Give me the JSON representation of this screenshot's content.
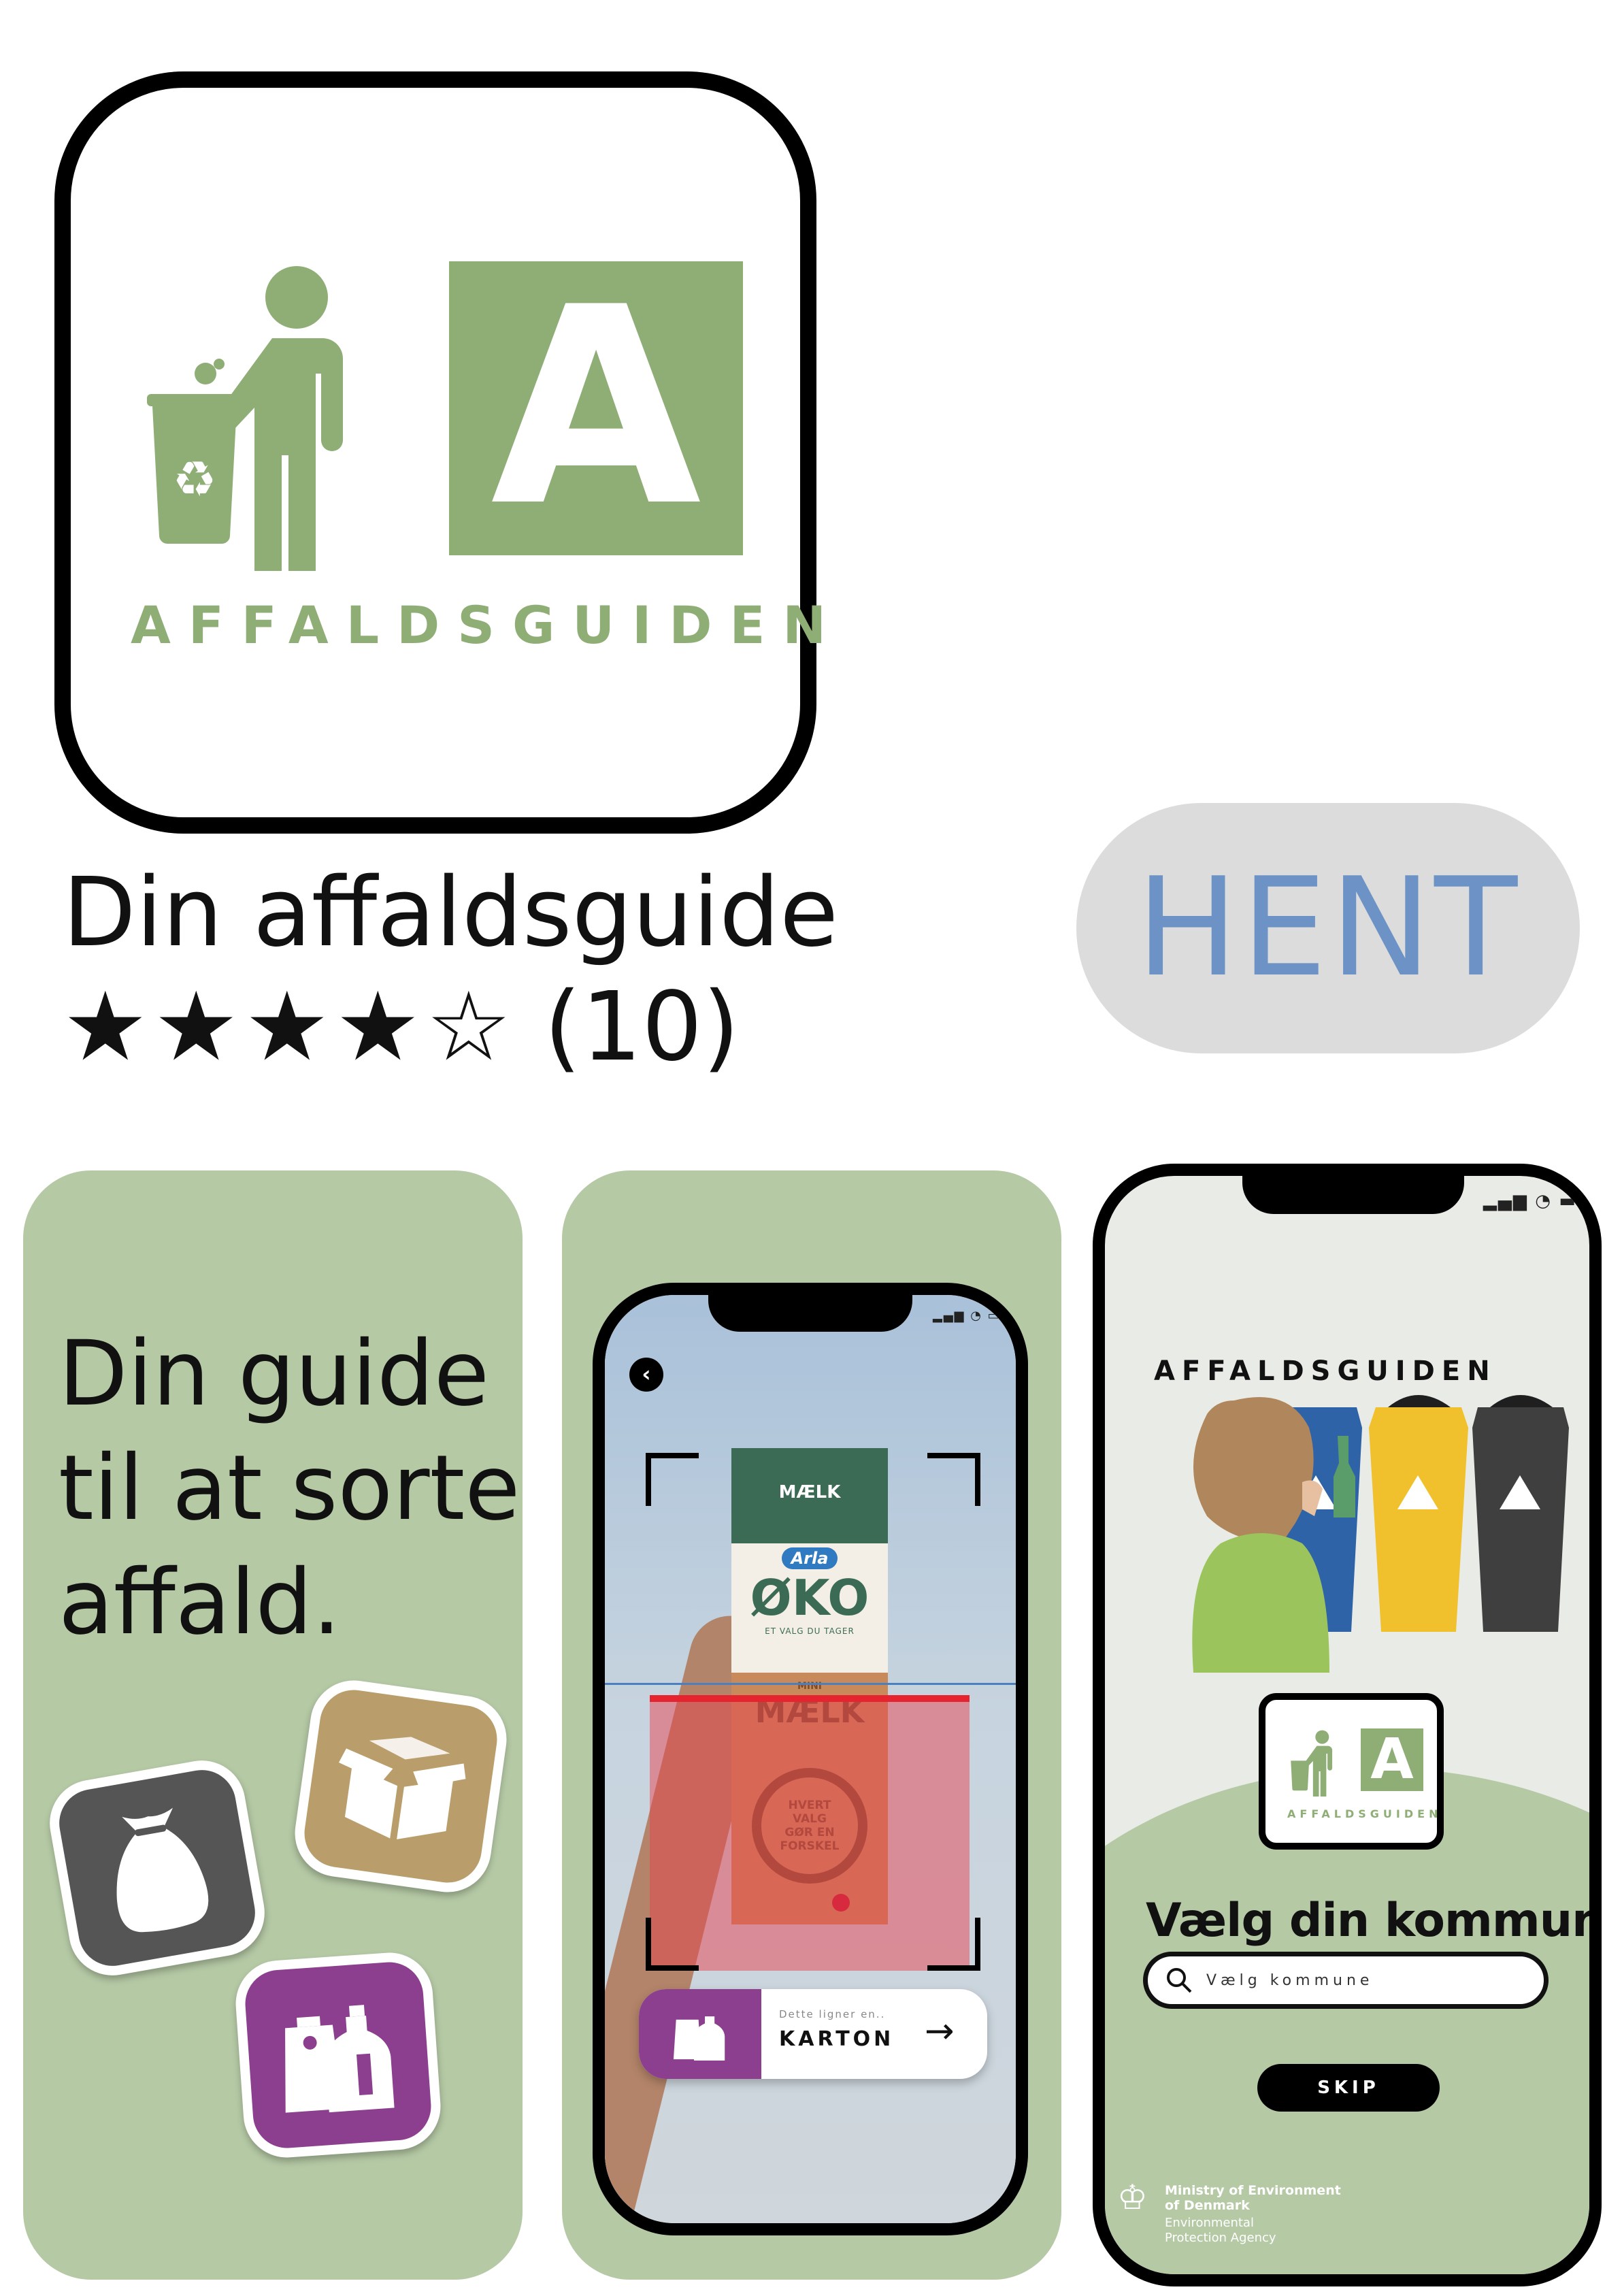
{
  "app": {
    "logo_text": "AFFALDSGUIDEN",
    "logo_letter": "A",
    "name": "Din affaldsguide",
    "rating": 4,
    "rating_max": 5,
    "rating_count": "(10)",
    "get_label": "HENT"
  },
  "colors": {
    "logo_green": "#8fae76",
    "card_green": "#b5c9a5",
    "get_text": "#6d93c6",
    "get_bg": "#dcdcdc",
    "residual_waste": "#555555",
    "cardboard": "#b99d6b",
    "plastic_cartons": "#8c3f8e"
  },
  "screens": [
    {
      "text": "Din guide\ntil at sorte\naffald.",
      "icons": [
        "trash-bag-icon",
        "cardboard-box-icon",
        "plastic-cartons-icon"
      ]
    },
    {
      "package": {
        "brand": "Arla",
        "product": "ØKO",
        "tagline": "ET VALG DU TAGER",
        "top_label": "MÆLK",
        "size_label": "MINI",
        "milk_label": "MÆLK",
        "slogan": "HVERT\nVALG\nGØR EN\nFORSKEL"
      },
      "result": {
        "hint": "Dette ligner en..",
        "label": "KARTON"
      }
    },
    {
      "header": "AFFALDSGUIDEN",
      "logo_text": "AFFALDSGUIDEN",
      "logo_letter": "A",
      "choose_title": "Vælg din kommune",
      "search_placeholder": "Vælg kommune",
      "skip_label": "SKIP",
      "footer_ministry": "Ministry of Environment\nof Denmark",
      "footer_agency": "Environmental\nProtection Agency"
    }
  ]
}
